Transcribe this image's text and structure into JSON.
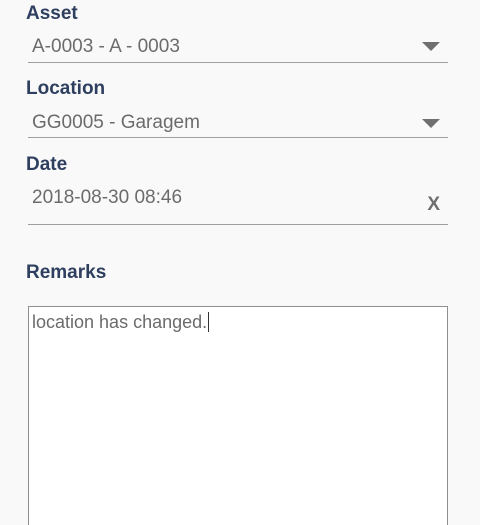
{
  "form": {
    "asset": {
      "label": "Asset",
      "value": "A-0003 - A - 0003",
      "icon": "chevron-down-icon"
    },
    "location": {
      "label": "Location",
      "value": "GG0005 - Garagem",
      "icon": "chevron-down-icon"
    },
    "date": {
      "label": "Date",
      "value": "2018-08-30 08:46",
      "clear_label": "X",
      "icon": "close-icon"
    },
    "remarks": {
      "label": "Remarks",
      "value": "location has changed."
    }
  },
  "colors": {
    "label": "#2f3f5f",
    "value_text": "#6b6b6b",
    "background": "#f9f9f9",
    "underline": "#9e9e9e"
  }
}
